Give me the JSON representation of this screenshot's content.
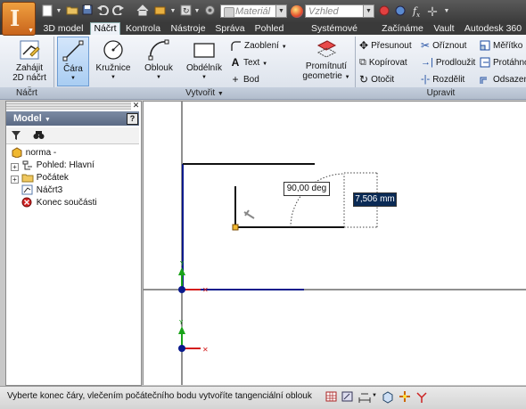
{
  "quick_access": {
    "material_combo": "Materiál",
    "appearance_combo": "Vzhled"
  },
  "tabs": [
    "3D model",
    "Náčrt",
    "Kontrola",
    "Nástroje",
    "Správa",
    "Pohled",
    "Systémové prostředí",
    "Začínáme",
    "Vault",
    "Autodesk 360"
  ],
  "active_tab": "Náčrt",
  "ribbon": {
    "nacrt_panel": {
      "label": "Náčrt",
      "start_sketch_line1": "Zahájit",
      "start_sketch_line2": "2D náčrt"
    },
    "vytvorit_panel": {
      "label": "Vytvořit",
      "line": "Čára",
      "circle": "Kružnice",
      "arc": "Oblouk",
      "rectangle": "Obdélník",
      "fillet": "Zaoblení",
      "text": "Text",
      "point": "Bod",
      "project_line1": "Promítnutí",
      "project_line2": "geometrie"
    },
    "upravit_panel": {
      "label": "Upravit",
      "move": "Přesunout",
      "copy": "Kopírovat",
      "rotate": "Otočit",
      "trim": "Oříznout",
      "extend": "Prodloužit",
      "split": "Rozdělit",
      "scale": "Měřítko",
      "stretch": "Protáhno",
      "offset": "Odsazen"
    }
  },
  "browser": {
    "title": "Model",
    "tree": [
      {
        "label": "norma -",
        "icon": "part-icon"
      },
      {
        "label": "Pohled: Hlavní",
        "icon": "view-icon"
      },
      {
        "label": "Počátek",
        "icon": "folder-icon"
      },
      {
        "label": "Náčrt3",
        "icon": "sketch-icon"
      },
      {
        "label": "Konec součásti",
        "icon": "end-of-part-icon"
      }
    ]
  },
  "canvas": {
    "angle_value": "90,00 deg",
    "length_value": "7,506 mm"
  },
  "status_text": "Vyberte konec čáry, vlečením počátečního bodu vytvoříte tangenciální oblouk",
  "colors": {
    "app_orange": "#e07b24",
    "ribbon_active": "#a9cdf2",
    "axis_blue": "#0a1a8c",
    "axis_green": "#1aa31a",
    "axis_red": "#d41c1c",
    "length_box": "#0a2a55"
  }
}
